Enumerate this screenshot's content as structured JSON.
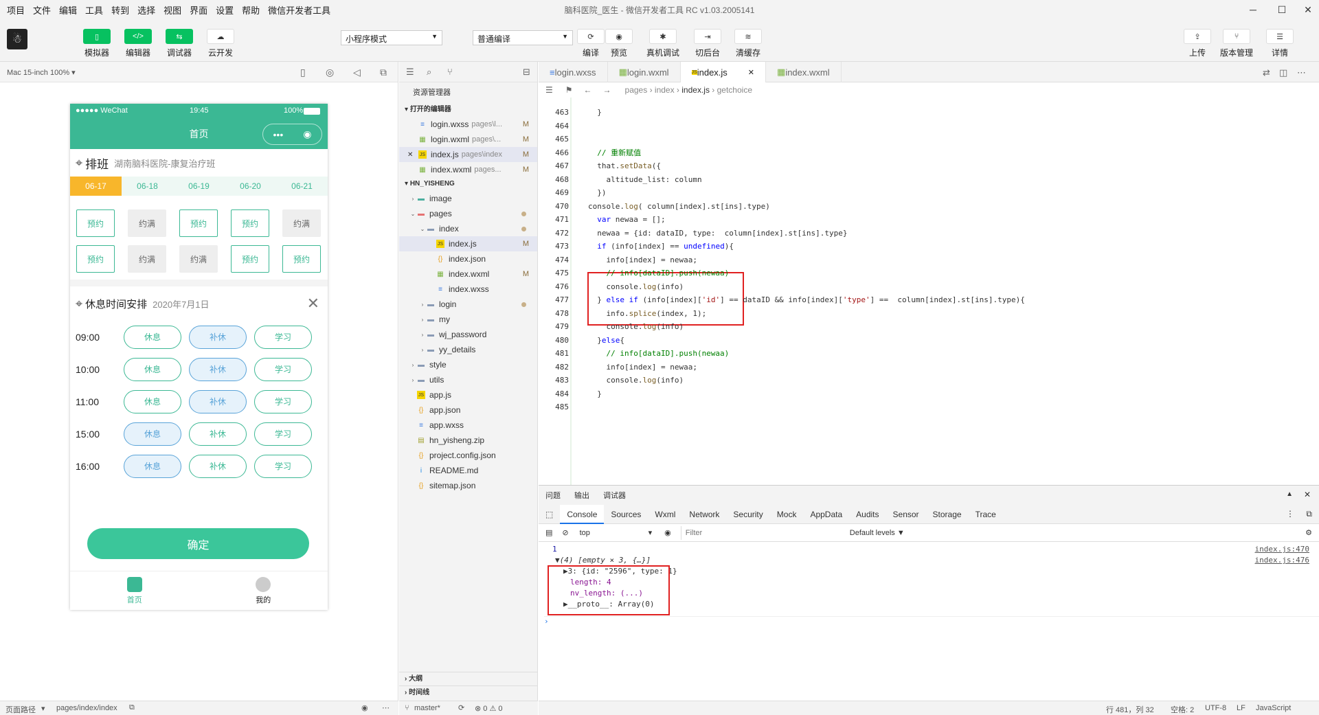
{
  "menu": [
    "项目",
    "文件",
    "编辑",
    "工具",
    "转到",
    "选择",
    "视图",
    "界面",
    "设置",
    "帮助",
    "微信开发者工具"
  ],
  "window_title": "脑科医院_医生 - 微信开发者工具 RC v1.03.2005141",
  "toolbar": {
    "simulator": "模拟器",
    "editor": "编辑器",
    "debugger": "调试器",
    "cloud": "云开发",
    "mode_select": "小程序模式",
    "compile_select": "普通编译",
    "compile": "编译",
    "preview": "预览",
    "real_debug": "真机调试",
    "background": "切后台",
    "clear_cache": "清缓存",
    "upload": "上传",
    "version": "版本管理",
    "details": "详情"
  },
  "sim": {
    "device": "Mac 15-inch 100% ▾"
  },
  "phone": {
    "status_left": "●●●●● WeChat",
    "status_time": "19:45",
    "status_batt": "100%",
    "nav_title": "首页",
    "schedule_title": "排班",
    "schedule_sub": "湖南脑科医院-康复治疗班",
    "dates": [
      "06-17",
      "06-18",
      "06-19",
      "06-20",
      "06-21"
    ],
    "slots": [
      "预约",
      "约满",
      "预约",
      "预约",
      "约满",
      "预约",
      "约满",
      "约满",
      "预约",
      "预约"
    ],
    "rest_title": "休息时间安排",
    "rest_date": "2020年7月1日",
    "times": [
      {
        "time": "09:00",
        "opts": [
          "休息",
          "补休",
          "学习"
        ],
        "sel": 1
      },
      {
        "time": "10:00",
        "opts": [
          "休息",
          "补休",
          "学习"
        ],
        "sel": 1
      },
      {
        "time": "11:00",
        "opts": [
          "休息",
          "补休",
          "学习"
        ],
        "sel": 1
      },
      {
        "time": "15:00",
        "opts": [
          "休息",
          "补休",
          "学习"
        ],
        "sel": 0
      },
      {
        "time": "16:00",
        "opts": [
          "休息",
          "补休",
          "学习"
        ],
        "sel": 0
      }
    ],
    "confirm": "确定",
    "tab_home": "首页",
    "tab_me": "我的"
  },
  "bottom_left": {
    "path_label": "页面路径",
    "path": "pages/index/index"
  },
  "explorer": {
    "title": "资源管理器",
    "open_editors": "打开的编辑器",
    "open": [
      {
        "name": "login.wxss",
        "sub": "pages\\l...",
        "badge": "M",
        "icon": "css"
      },
      {
        "name": "login.wxml",
        "sub": "pages\\...",
        "badge": "M",
        "icon": "xml"
      },
      {
        "name": "index.js",
        "sub": "pages\\index",
        "badge": "M",
        "icon": "js"
      },
      {
        "name": "index.wxml",
        "sub": "pages...",
        "badge": "M",
        "icon": "xml"
      }
    ],
    "project": "HN_YISHENG",
    "tree": [
      {
        "name": "image",
        "lvl": 1,
        "type": "folder-img",
        "arrow": "›",
        "mark": ""
      },
      {
        "name": "pages",
        "lvl": 1,
        "type": "folder-red",
        "arrow": "⌄",
        "mark": "dot"
      },
      {
        "name": "index",
        "lvl": 2,
        "type": "folder",
        "arrow": "⌄",
        "mark": "dot"
      },
      {
        "name": "index.js",
        "lvl": 3,
        "type": "js",
        "arrow": "",
        "mark": "M"
      },
      {
        "name": "index.json",
        "lvl": 3,
        "type": "json",
        "arrow": "",
        "mark": ""
      },
      {
        "name": "index.wxml",
        "lvl": 3,
        "type": "xml",
        "arrow": "",
        "mark": "M"
      },
      {
        "name": "index.wxss",
        "lvl": 3,
        "type": "css",
        "arrow": "",
        "mark": ""
      },
      {
        "name": "login",
        "lvl": 2,
        "type": "folder",
        "arrow": "›",
        "mark": "dot"
      },
      {
        "name": "my",
        "lvl": 2,
        "type": "folder",
        "arrow": "›",
        "mark": ""
      },
      {
        "name": "wj_password",
        "lvl": 2,
        "type": "folder",
        "arrow": "›",
        "mark": ""
      },
      {
        "name": "yy_details",
        "lvl": 2,
        "type": "folder",
        "arrow": "›",
        "mark": ""
      },
      {
        "name": "style",
        "lvl": 1,
        "type": "folder",
        "arrow": "›",
        "mark": ""
      },
      {
        "name": "utils",
        "lvl": 1,
        "type": "folder",
        "arrow": "›",
        "mark": ""
      },
      {
        "name": "app.js",
        "lvl": 1,
        "type": "js",
        "arrow": "",
        "mark": ""
      },
      {
        "name": "app.json",
        "lvl": 1,
        "type": "json",
        "arrow": "",
        "mark": ""
      },
      {
        "name": "app.wxss",
        "lvl": 1,
        "type": "css",
        "arrow": "",
        "mark": ""
      },
      {
        "name": "hn_yisheng.zip",
        "lvl": 1,
        "type": "zip",
        "arrow": "",
        "mark": ""
      },
      {
        "name": "project.config.json",
        "lvl": 1,
        "type": "json",
        "arrow": "",
        "mark": ""
      },
      {
        "name": "README.md",
        "lvl": 1,
        "type": "info",
        "arrow": "",
        "mark": ""
      },
      {
        "name": "sitemap.json",
        "lvl": 1,
        "type": "json",
        "arrow": "",
        "mark": ""
      }
    ],
    "outline": "大纲",
    "timeline": "时间线"
  },
  "branch": {
    "name": "master*",
    "errors": "⊗ 0 ⚠ 0"
  },
  "tabs": [
    {
      "name": "login.wxss",
      "icon": "css"
    },
    {
      "name": "login.wxml",
      "icon": "xml"
    },
    {
      "name": "index.js",
      "icon": "js",
      "active": true
    },
    {
      "name": "index.wxml",
      "icon": "xml"
    }
  ],
  "breadcrumb": [
    "pages",
    "index",
    "index.js",
    "getchoice"
  ],
  "code": [
    {
      "n": "463",
      "t": "  }"
    },
    {
      "n": "464",
      "t": ""
    },
    {
      "n": "465",
      "t": ""
    },
    {
      "n": "466",
      "t": "  // 重新赋值"
    },
    {
      "n": "467",
      "t": "  that.setData({"
    },
    {
      "n": "468",
      "t": "    altitude_list: column"
    },
    {
      "n": "469",
      "t": "  })"
    },
    {
      "n": "470",
      "t": "console.log( column[index].st[ins].type)"
    },
    {
      "n": "471",
      "t": "  var newaa = [];"
    },
    {
      "n": "472",
      "t": "  newaa = {id: dataID, type:  column[index].st[ins].type}"
    },
    {
      "n": "473",
      "t": "  if (info[index] == undefined){"
    },
    {
      "n": "474",
      "t": "    info[index] = newaa;"
    },
    {
      "n": "475",
      "t": "    // info[dataID].push(newaa)"
    },
    {
      "n": "476",
      "t": "    console.log(info)"
    },
    {
      "n": "477",
      "t": "  } else if (info[index]['id'] == dataID && info[index]['type'] ==  column[index].st[ins].type){"
    },
    {
      "n": "478",
      "t": "    info.splice(index, 1);"
    },
    {
      "n": "479",
      "t": "    console.log(info)"
    },
    {
      "n": "480",
      "t": "  }else{"
    },
    {
      "n": "481",
      "t": "    // info[dataID].push(newaa)"
    },
    {
      "n": "482",
      "t": "    info[index] = newaa;"
    },
    {
      "n": "483",
      "t": "    console.log(info)"
    },
    {
      "n": "484",
      "t": "  }"
    },
    {
      "n": "485",
      "t": ""
    }
  ],
  "devtools": {
    "top_tabs": [
      "问题",
      "输出",
      "调试器"
    ],
    "tabs": [
      "Console",
      "Sources",
      "Wxml",
      "Network",
      "Security",
      "Mock",
      "AppData",
      "Audits",
      "Sensor",
      "Storage",
      "Trace"
    ],
    "context": "top",
    "filter_placeholder": "Filter",
    "levels": "Default levels ▼",
    "lines": [
      {
        "text": "1",
        "link": "index.js:470"
      },
      {
        "text": "▼(4) [empty × 3, {…}]",
        "link": "index.js:476"
      },
      {
        "text": "▶3: {id: \"2596\", type: 1}",
        "link": ""
      },
      {
        "text": "length: 4",
        "link": ""
      },
      {
        "text": "nv_length: (...)",
        "link": ""
      },
      {
        "text": "▶__proto__: Array(0)",
        "link": ""
      }
    ]
  },
  "status": {
    "pos": "行 481，列 32",
    "spaces": "空格: 2",
    "enc": "UTF-8",
    "eol": "LF",
    "lang": "JavaScript"
  }
}
